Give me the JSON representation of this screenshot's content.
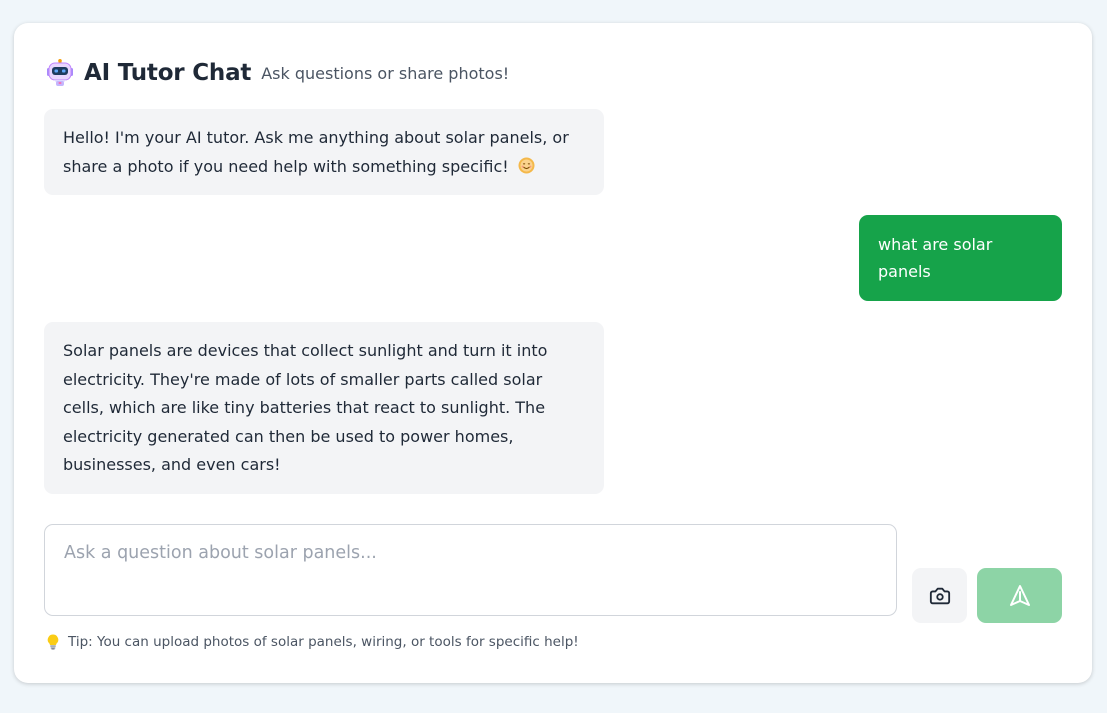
{
  "header": {
    "title": "AI Tutor Chat",
    "subtitle": "Ask questions or share photos!",
    "icon": "robot-icon"
  },
  "messages": [
    {
      "role": "assistant",
      "text": "Hello! I'm your AI tutor. Ask me anything about solar panels, or share a photo if you need help with something specific!",
      "emoji": "sun-smile-icon"
    },
    {
      "role": "user",
      "text": "what are solar panels"
    },
    {
      "role": "assistant",
      "text": "Solar panels are devices that collect sunlight and turn it into electricity.  They're made of lots of smaller parts called solar cells, which are like tiny batteries that react to sunlight.  The electricity generated can then be used to power homes, businesses, and even cars!"
    }
  ],
  "composer": {
    "placeholder": "Ask a question about solar panels...",
    "value": "",
    "camera_icon": "camera-icon",
    "send_icon": "send-icon"
  },
  "tip": {
    "icon": "lightbulb-icon",
    "text": "Tip: You can upload photos of solar panels, wiring, or tools for specific help!"
  },
  "colors": {
    "page_background": "#f0f6fa",
    "user_bubble": "#16a34a",
    "assistant_bubble": "#f3f4f6",
    "send_button_disabled": "#8dd4a6"
  }
}
